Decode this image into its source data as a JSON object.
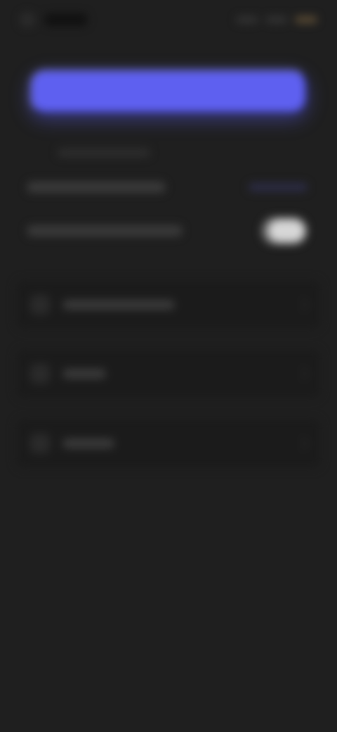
{
  "status": {
    "time": "",
    "signal": "",
    "wifi": "",
    "battery": ""
  },
  "primary_action": {
    "label": ""
  },
  "link": {
    "label": ""
  },
  "settings": [
    {
      "label": "",
      "value": ""
    },
    {
      "label": "",
      "state": "on"
    }
  ],
  "list_items": [
    {
      "label": ""
    },
    {
      "label": ""
    },
    {
      "label": ""
    }
  ],
  "nav": [
    {
      "label": ""
    },
    {
      "label": ""
    },
    {
      "label": ""
    },
    {
      "label": ""
    },
    {
      "label": ""
    }
  ],
  "colors": {
    "background": "#1f1f1f",
    "primary": "#5e60f0",
    "toggle_on": "#d7d7d7"
  }
}
